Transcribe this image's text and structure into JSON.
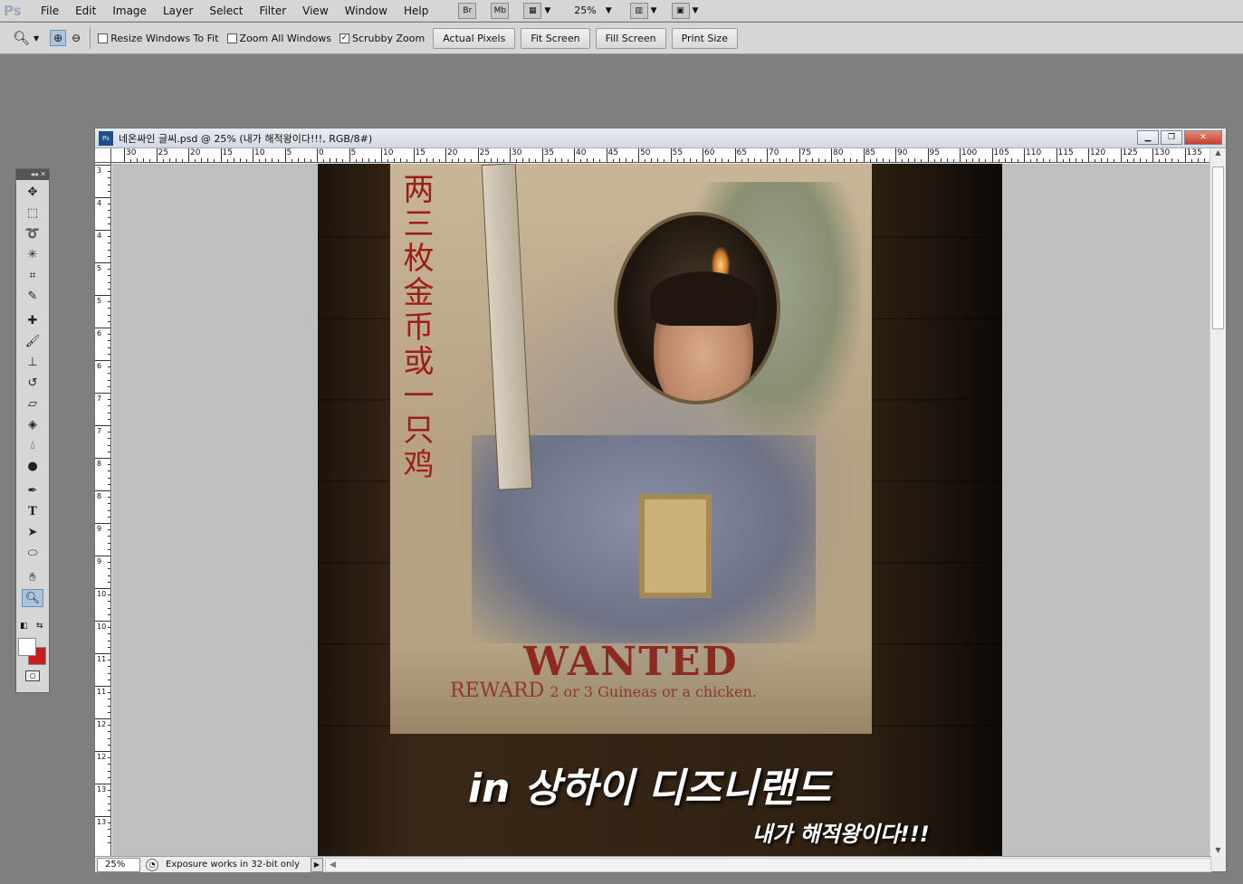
{
  "app": {
    "logo": "Ps",
    "menu": [
      "File",
      "Edit",
      "Image",
      "Layer",
      "Select",
      "Filter",
      "View",
      "Window",
      "Help"
    ],
    "toolbar_buttons": [
      "Br",
      "Mb"
    ],
    "zoom_level": "25%"
  },
  "options_bar": {
    "tool_icon": "zoom-icon",
    "checkboxes": [
      {
        "label": "Resize Windows To Fit",
        "checked": false
      },
      {
        "label": "Zoom All Windows",
        "checked": false
      },
      {
        "label": "Scrubby Zoom",
        "checked": true
      }
    ],
    "buttons": [
      "Actual Pixels",
      "Fit Screen",
      "Fill Screen",
      "Print Size"
    ]
  },
  "document": {
    "title": "네온싸인 글씨.psd @ 25% (내가 해적왕이다!!!, RGB/8#)",
    "ruler_top": [
      "30",
      "25",
      "20",
      "15",
      "10",
      "5",
      "0",
      "5",
      "10",
      "15",
      "20",
      "25",
      "30",
      "35",
      "40",
      "45",
      "50",
      "55",
      "60",
      "65",
      "70",
      "75",
      "80",
      "85",
      "90",
      "95",
      "100",
      "105",
      "110",
      "115",
      "120",
      "125",
      "130",
      "135"
    ],
    "ruler_left": [
      "3",
      "4",
      "4",
      "5",
      "5",
      "6",
      "6",
      "7",
      "7",
      "8",
      "8",
      "9",
      "9",
      "10",
      "10",
      "11",
      "11",
      "12",
      "12",
      "13",
      "13"
    ],
    "image_text": {
      "chinese_vertical": "两三枚金币或一只鸡",
      "wanted": "WANTED",
      "reward": "REWARD",
      "reward_sub": "2 or 3 Guineas or a chicken.",
      "caption_main": "in 상하이 디즈니랜드",
      "caption_sub": "내가 해적왕이다!!!"
    }
  },
  "status_bar": {
    "zoom": "25%",
    "info": "Exposure works in 32-bit only"
  },
  "colors": {
    "foreground": "#ffffff",
    "background": "#c81e22"
  }
}
